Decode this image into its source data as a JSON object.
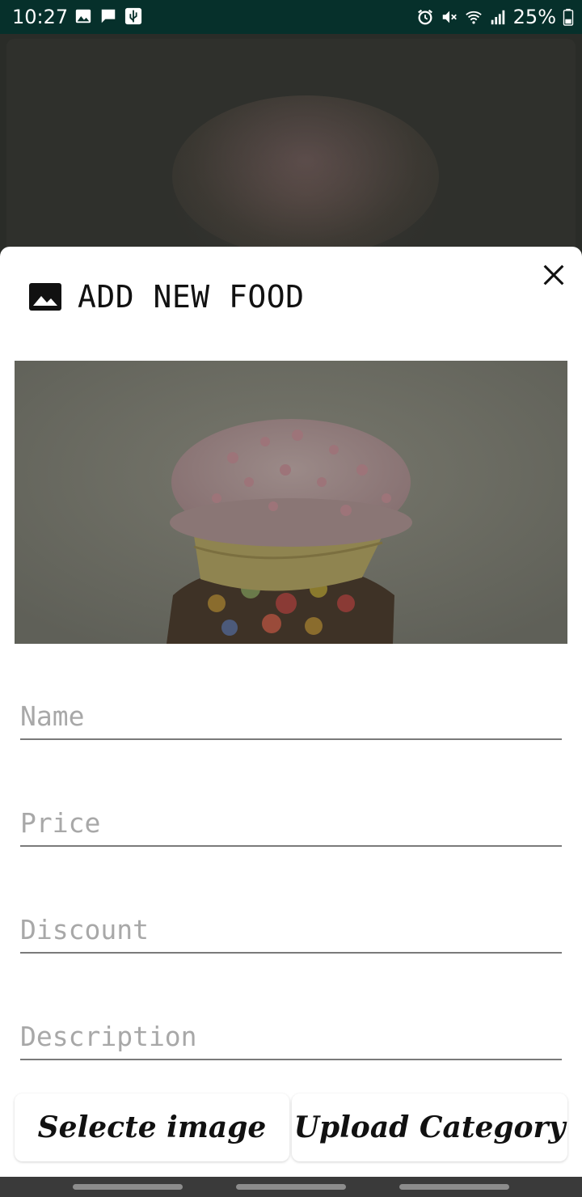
{
  "status_bar": {
    "time": "10:27",
    "left_icons": [
      "image-icon",
      "chat-icon",
      "usb-icon"
    ],
    "right_icons": [
      "alarm-icon",
      "mute-icon",
      "wifi-icon",
      "signal-icon"
    ],
    "battery": "25%"
  },
  "sheet": {
    "title": "ADD NEW FOOD",
    "title_icon": "image-icon",
    "close_icon": "close-icon"
  },
  "form": {
    "name_placeholder": "Name",
    "name_value": "",
    "price_placeholder": "Price",
    "price_value": "",
    "discount_placeholder": "Discount",
    "discount_value": "",
    "description_placeholder": "Description",
    "description_value": ""
  },
  "actions": {
    "select_image": "Selecte image",
    "upload_category": "Upload Category"
  },
  "colors": {
    "status_bar": "#06302b",
    "sheet_background": "#ffffff",
    "dim_overlay": "#2a2c28"
  }
}
